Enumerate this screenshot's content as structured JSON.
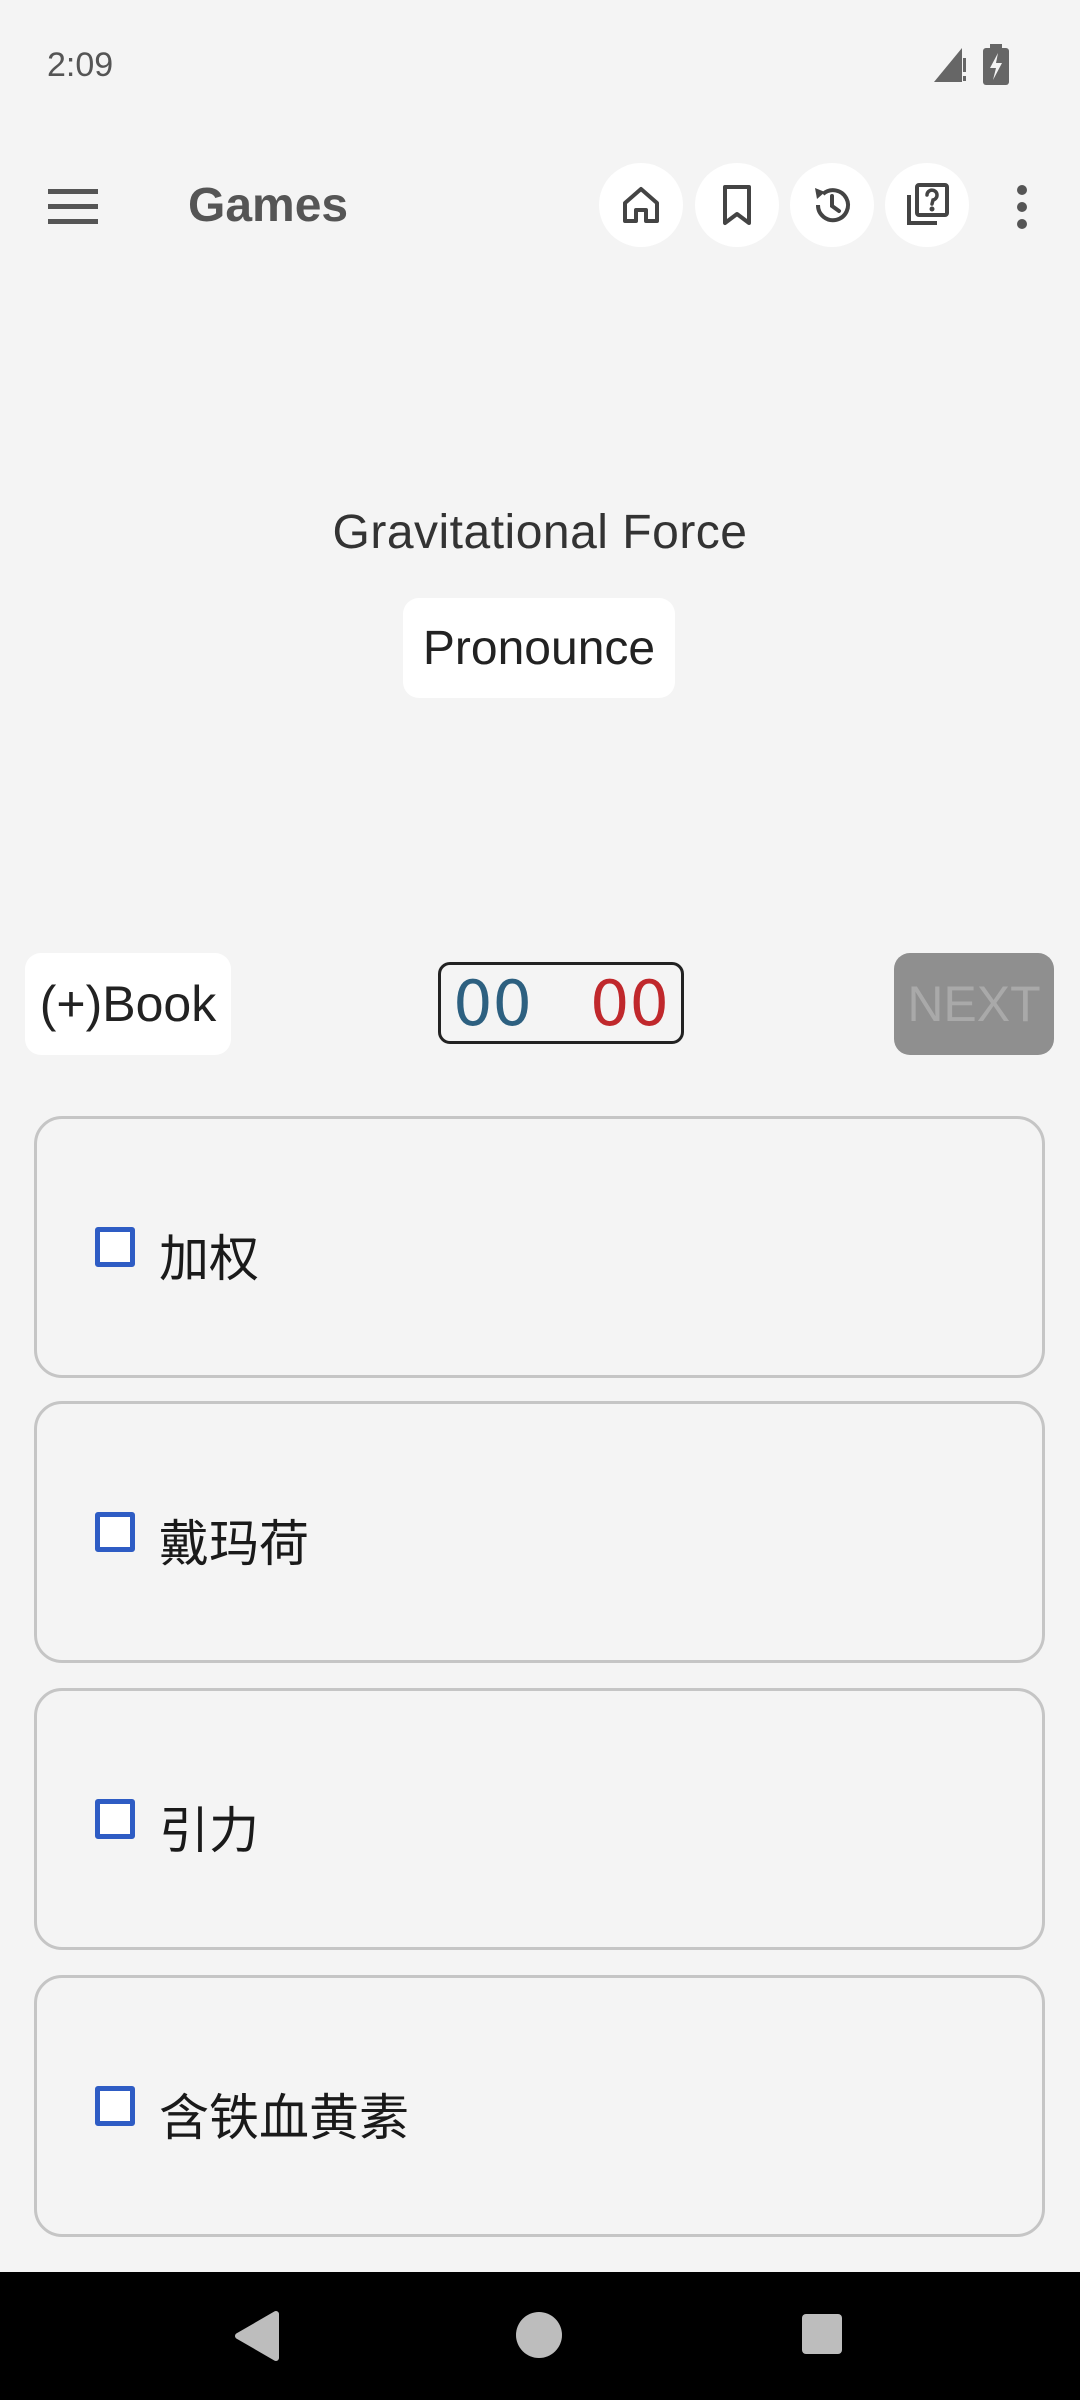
{
  "status_bar": {
    "time": "2:09",
    "icons": [
      "signal-icon",
      "battery-charging-icon"
    ]
  },
  "app_bar": {
    "title": "Games",
    "actions": [
      "home-icon",
      "bookmark-icon",
      "history-icon",
      "quiz-icon",
      "more-vert-icon"
    ]
  },
  "question": {
    "word": "Gravitational Force",
    "pronounce_label": "Pronounce"
  },
  "controls": {
    "book_label": "(+)Book",
    "score_correct": "00",
    "score_wrong": "00",
    "next_label": "NEXT"
  },
  "options": [
    {
      "label": "加权",
      "checked": false
    },
    {
      "label": "戴玛荷",
      "checked": false
    },
    {
      "label": "引力",
      "checked": false
    },
    {
      "label": "含铁血黄素",
      "checked": false
    }
  ],
  "colors": {
    "background": "#f4f4f4",
    "checkbox": "#2e5cc4",
    "score_correct": "#2d6080",
    "score_wrong": "#c0282c",
    "next_disabled_bg": "#8f8f8f"
  }
}
